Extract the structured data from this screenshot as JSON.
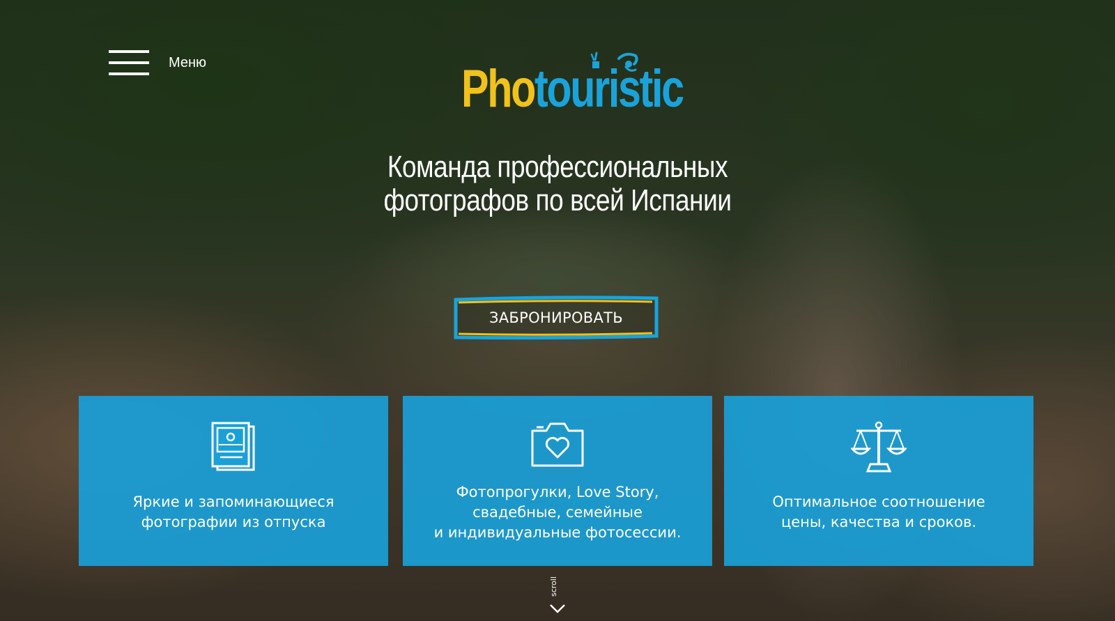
{
  "menu": {
    "label": "Меню",
    "icon": "hamburger-icon"
  },
  "logo": {
    "part1": "Pho",
    "part2": "touristic",
    "colors": {
      "yellow": "#f1c21b",
      "blue": "#1aa3da"
    }
  },
  "hero": {
    "headline_line1": "Команда профессиональных",
    "headline_line2": "фотографов по всей Испании"
  },
  "cta": {
    "label": "ЗАБРОНИРОВАТЬ"
  },
  "features": [
    {
      "icon": "photos-icon",
      "text": "Яркие и запоминающиеся\nфотографии из отпуска"
    },
    {
      "icon": "camera-heart-icon",
      "text": "Фотопрогулки, Love Story,\nсвадебные, семейные\nи индивидуальные фотосессии."
    },
    {
      "icon": "scales-icon",
      "text": "Оптимальное соотношение\nцены, качества и сроков."
    }
  ],
  "scroll": {
    "label": "scroll",
    "icon": "chevron-down-icon"
  },
  "accent_color": "#1aa0d8"
}
